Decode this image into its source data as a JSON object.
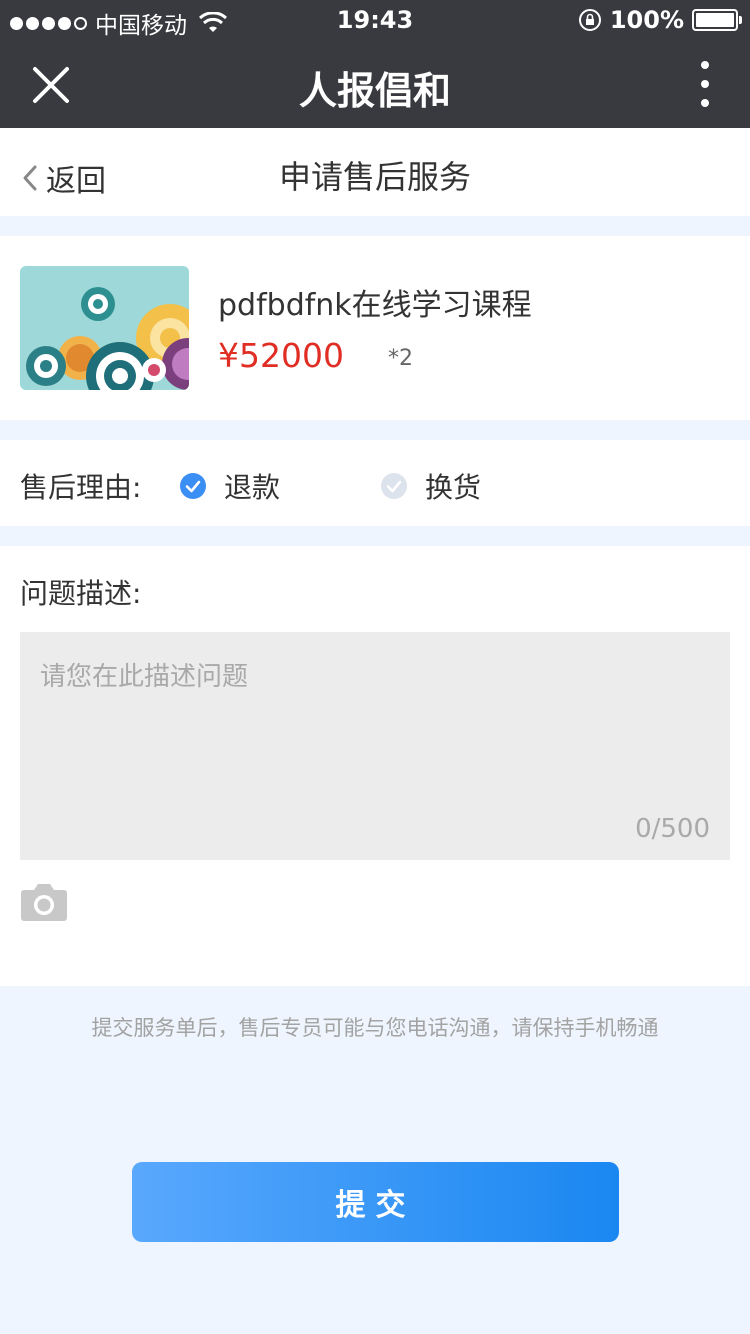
{
  "status_bar": {
    "carrier": "中国移动",
    "time": "19:43",
    "battery": "100%",
    "signal_icon": "signal-dots-icon",
    "wifi_icon": "wifi-icon",
    "lock_icon": "rotation-lock-icon",
    "battery_icon": "battery-icon"
  },
  "nav": {
    "title": "人报倡和",
    "close_icon": "close-icon",
    "more_icon": "more-vertical-icon"
  },
  "header": {
    "back_label": "返回",
    "title": "申请售后服务"
  },
  "product": {
    "name": "pdfbdfnk在线学习课程",
    "price": "¥52000",
    "quantity": "*2"
  },
  "reason": {
    "label": "售后理由:",
    "options": [
      {
        "label": "退款",
        "selected": true
      },
      {
        "label": "换货",
        "selected": false
      }
    ]
  },
  "description": {
    "label": "问题描述:",
    "placeholder": "请您在此描述问题",
    "value": "",
    "counter": "0/500",
    "camera_icon": "camera-icon"
  },
  "notice": "提交服务单后，售后专员可能与您电话沟通，请保持手机畅通",
  "submit_label": "提交",
  "colors": {
    "nav_bg": "#393a3f",
    "price": "#e02e24",
    "accent": "#3b8ef3",
    "page_bg": "#eef5fe",
    "button_gradient_start": "#59a8fd",
    "button_gradient_end": "#1a87f1"
  }
}
